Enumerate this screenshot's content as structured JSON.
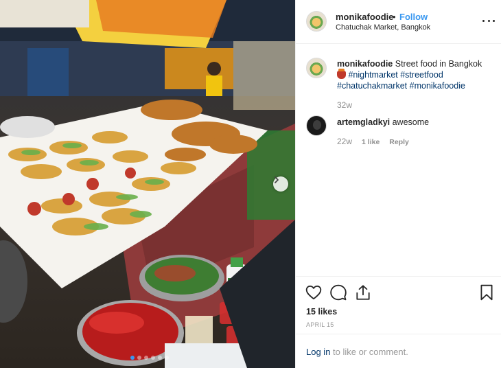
{
  "post": {
    "photo": {
      "alt": "",
      "carousel_total": 6,
      "carousel_active": 1,
      "next_icon": "chevron-right-icon"
    },
    "header": {
      "username": "monikafoodie",
      "separator": "•",
      "follow_label": "Follow",
      "location": "Chatuchak Market, Bangkok",
      "more_icon": "more-options-icon"
    },
    "caption": {
      "username": "monikafoodie",
      "text": "Street food in Bangkok",
      "emoji_icon": "food-emoji-icon",
      "hashtags": [
        "#nightmarket",
        "#streetfood",
        "#chatuchakmarket",
        "#monikafoodie"
      ],
      "time": "32w"
    },
    "comments": [
      {
        "username": "artemgladkyi",
        "text": "awesome",
        "time": "22w",
        "likes_label": "1 like",
        "reply_label": "Reply"
      }
    ],
    "actions": {
      "like_icon": "heart-icon",
      "comment_icon": "comment-icon",
      "share_icon": "share-icon",
      "save_icon": "bookmark-icon"
    },
    "likes": "15 likes",
    "date": "APRIL 15",
    "login": {
      "link": "Log in",
      "text": "to like or comment."
    }
  },
  "colors": {
    "accent": "#3897f0",
    "hashtag": "#003569",
    "muted": "#8e8e8e",
    "border": "#efefef"
  }
}
